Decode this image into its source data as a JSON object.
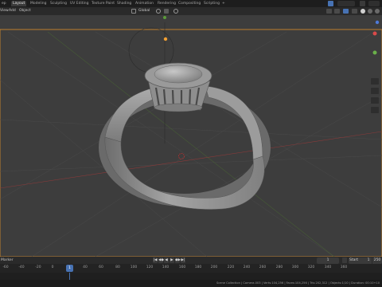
{
  "topbar": {
    "app_label": "ep",
    "tabs": [
      "Layout",
      "Modeling",
      "Sculpting",
      "UV Editing",
      "Texture Paint",
      "Shading",
      "Animation",
      "Rendering",
      "Compositing",
      "Scripting",
      "+"
    ],
    "active_tab": "Layout"
  },
  "viewport_header": {
    "menus": [
      "View",
      "Add",
      "Object"
    ],
    "orientation": "Global"
  },
  "timeline": {
    "marker_label": "Marker",
    "ticks": [
      "-60",
      "-40",
      "-20",
      "0",
      "20",
      "40",
      "60",
      "80",
      "100",
      "120",
      "140",
      "160",
      "180",
      "200",
      "220",
      "240",
      "260",
      "280",
      "300",
      "320",
      "340",
      "360"
    ],
    "current_frame": "1",
    "frame_field": "1",
    "start_label": "Start",
    "start_value": "1",
    "end_value": "250",
    "playback_buttons": [
      "|◀",
      "◀◆",
      "◀",
      "▶",
      "◆▶",
      "▶|"
    ]
  },
  "status": {
    "text": "Scene Collection | Camera.003 | Verts:104,256 | Faces:104,256 | Tris:202,312 | Objects:1/10 | Duration: 00:10+10"
  },
  "colors": {
    "viewport_bg": "#3d3d3d",
    "accent": "#4772b3",
    "ring": "#9a9a9a"
  },
  "icons": [
    "filter-icon",
    "view-icon",
    "overlay-icon",
    "shading-solid-icon",
    "gizmo-axis-icon",
    "play-icon",
    "light-icon"
  ]
}
